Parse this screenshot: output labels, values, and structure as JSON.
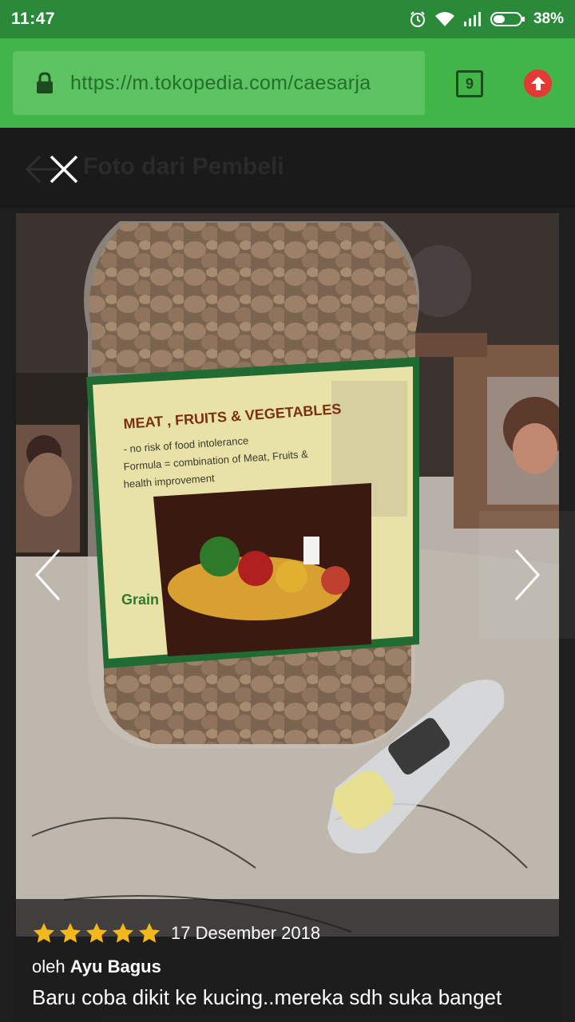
{
  "status_bar": {
    "time": "11:47",
    "battery": "38%",
    "icons": [
      "alarm-icon",
      "wifi-icon",
      "signal-icon",
      "battery-icon"
    ]
  },
  "browser": {
    "url": "https://m.tokopedia.com/caesarja",
    "tab_count": "9",
    "colors": {
      "toolbar": "#42b549",
      "status": "#2a8a3a",
      "upload": "#e53935"
    }
  },
  "header": {
    "title": "Foto dari Pembeli"
  },
  "photo": {
    "label_heading": "MEAT , FRUITS & VEGETABLES",
    "label_line1": "- no risk of food intolerance",
    "label_line2": "Formula = combination of Meat, Fruits &",
    "label_line3": "health improvement",
    "label_side": "Grain"
  },
  "review": {
    "rating": 5,
    "date": "17 Desember 2018",
    "by_prefix": "oleh",
    "reviewer": "Ayu Bagus",
    "text": "Baru coba dikit ke kucing..mereka sdh suka banget",
    "star_color": "#f5b81c"
  }
}
